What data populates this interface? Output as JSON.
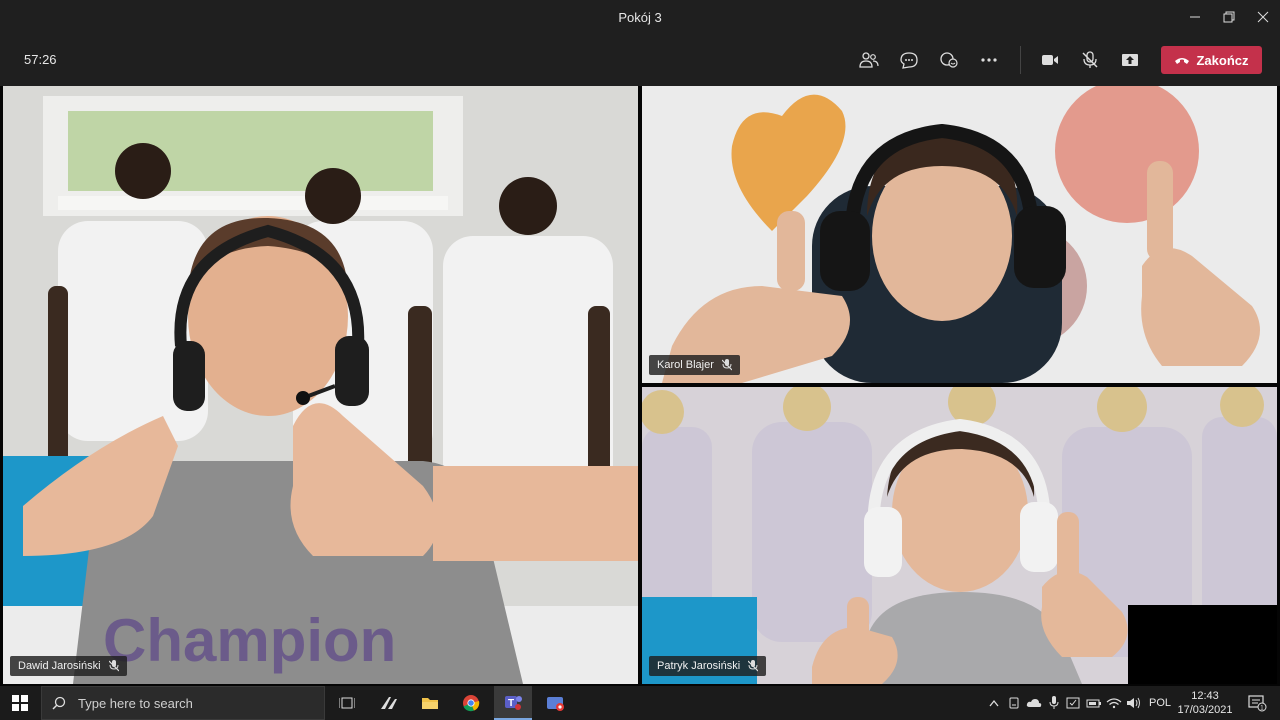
{
  "window": {
    "title": "Pokój 3"
  },
  "toolbar": {
    "timer": "57:26",
    "end_label": "Zakończ"
  },
  "participants": [
    {
      "name": "Dawid Jarosiński"
    },
    {
      "name": "Karol Blajer"
    },
    {
      "name": "Patryk Jarosiński"
    }
  ],
  "tiles": {
    "left_shirt_text": "Champion"
  },
  "taskbar": {
    "search_placeholder": "Type here to search",
    "language": "POL",
    "time": "12:43",
    "date": "17/03/2021",
    "notification_count": "1"
  },
  "colors": {
    "end_button": "#c4314b",
    "chrome": "#1f1f1f",
    "taskbar": "#1b1b1b"
  }
}
